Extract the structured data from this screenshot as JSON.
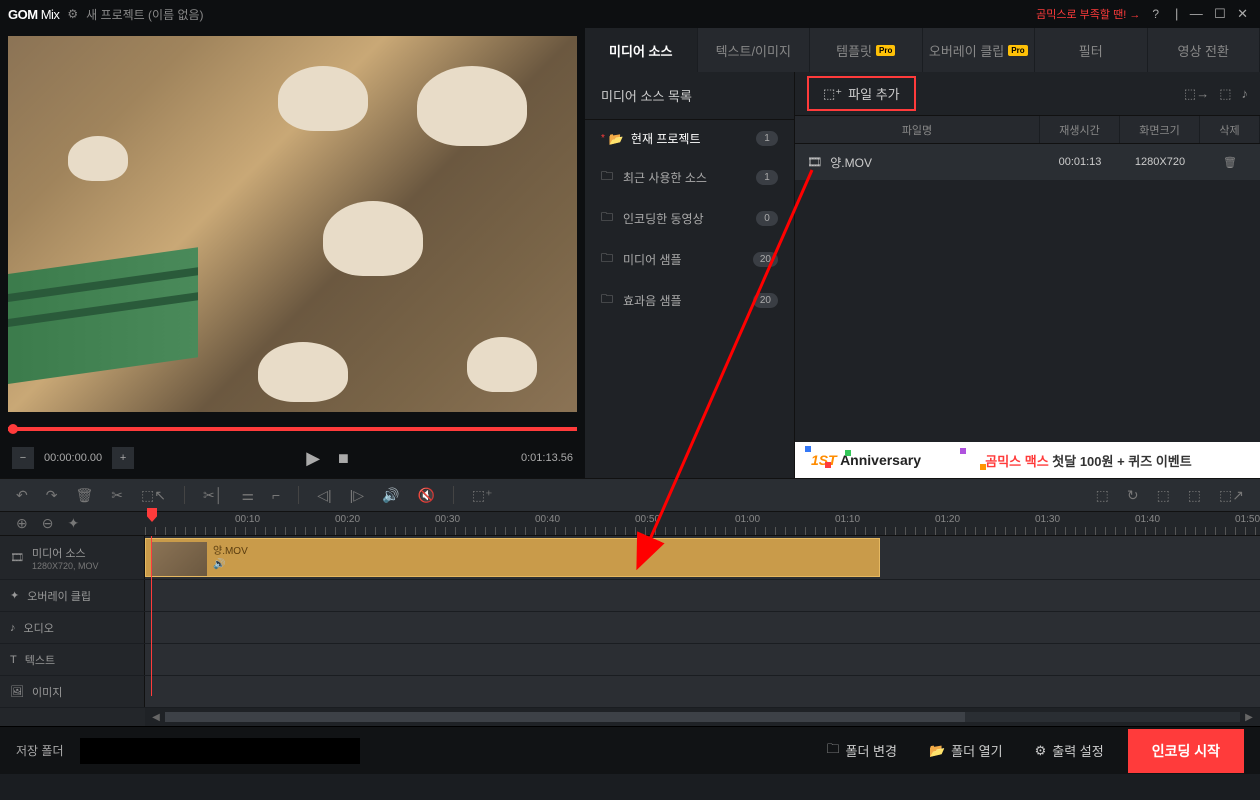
{
  "titlebar": {
    "logo_main": "GOM",
    "logo_sub": "Mix",
    "project_name": "새 프로젝트 (이름 없음)",
    "promo": "곰믹스로 부족할 땐! →",
    "help": "?",
    "sep": "|",
    "min": "—",
    "max": "☐",
    "close": "✕"
  },
  "playback": {
    "minus": "−",
    "time": "00:00:00.00",
    "plus": "+",
    "play": "▶",
    "stop": "■",
    "duration": "0:01:13.56"
  },
  "tabs": {
    "media": "미디어 소스",
    "text": "텍스트/이미지",
    "template": "템플릿",
    "overlay": "오버레이 클립",
    "filter": "필터",
    "transition": "영상 전환",
    "pro": "Pro"
  },
  "sources": {
    "header": "미디어 소스 목록",
    "current": "현재 프로젝트",
    "current_count": "1",
    "recent": "최근 사용한 소스",
    "recent_count": "1",
    "encoded": "인코딩한 동영상",
    "encoded_count": "0",
    "media_sample": "미디어 샘플",
    "media_sample_count": "20",
    "sound_sample": "효과음 샘플",
    "sound_sample_count": "20"
  },
  "file_toolbar": {
    "add_file": "파일 추가"
  },
  "file_headers": {
    "name": "파일명",
    "duration": "재생시간",
    "size": "화면크기",
    "delete": "삭제"
  },
  "files": {
    "row0": {
      "name": "양.MOV",
      "duration": "00:01:13",
      "size": "1280X720"
    }
  },
  "banner": {
    "first": "1ST",
    "anniversary": "Anniversary",
    "text_red": "곰믹스 맥스",
    "text_rest": " 첫달 100원 + 퀴즈 이벤트"
  },
  "ruler": {
    "t10": "00:10",
    "t20": "00:20",
    "t30": "00:30",
    "t40": "00:40",
    "t50": "00:50",
    "t60": "01:00",
    "t70": "01:10",
    "t80": "01:20",
    "t90": "01:30",
    "t100": "01:40",
    "t110": "01:50"
  },
  "tracks": {
    "media": "미디어 소스",
    "media_sub": "1280X720, MOV",
    "overlay": "오버레이 클립",
    "audio": "오디오",
    "text": "텍스트",
    "image": "이미지",
    "clip_name": "양.MOV"
  },
  "footer": {
    "save_label": "저장 폴더",
    "change_folder": "폴더 변경",
    "open_folder": "폴더 열기",
    "output_settings": "출력 설정",
    "encode_start": "인코딩 시작"
  }
}
